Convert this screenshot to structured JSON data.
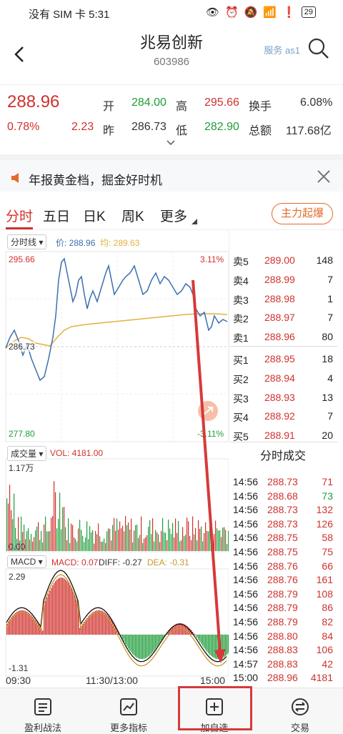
{
  "status": {
    "carrier": "没有 SIM 卡 5:31",
    "battery": "29"
  },
  "nav": {
    "title": "兆易创新",
    "code": "603986",
    "service": "服务 as1"
  },
  "quote": {
    "price": "288.96",
    "pct": "0.78%",
    "change": "2.23",
    "open_label": "开",
    "open": "284.00",
    "high_label": "高",
    "high": "295.66",
    "turnover_label": "换手",
    "turnover": "6.08%",
    "prev_label": "昨",
    "prev": "286.73",
    "low_label": "低",
    "low": "282.90",
    "amount_label": "总额",
    "amount": "117.68亿"
  },
  "banner": {
    "text": "年报黄金档，掘金好时机"
  },
  "tabs": {
    "t1": "分时",
    "t2": "五日",
    "t3": "日K",
    "t4": "周K",
    "t5": "更多",
    "action": "主力起爆"
  },
  "chart": {
    "mode_label": "分时线 ▾",
    "price_legend": "价: 288.96",
    "avg_legend": "均: 289.63",
    "y_top": "295.66",
    "y_mid": "286.73",
    "y_bot": "277.80",
    "pct_top": "3.11%",
    "pct_bot": "-3.11%",
    "vol_label": "成交量 ▾",
    "vol_value": "VOL: 4181.00",
    "vol_max": "1.17万",
    "vol_zero": "0.00",
    "macd_label": "MACD ▾",
    "macd_value": "MACD: 0.07",
    "diff_value": "DIFF: -0.27",
    "dea_value": "DEA: -0.31",
    "macd_top": "2.29",
    "macd_bot": "-1.31",
    "x_start": "09:30",
    "x_mid": "11:30/13:00",
    "x_end": "15:00"
  },
  "orderbook": [
    {
      "label": "卖5",
      "price": "289.00",
      "vol": "148"
    },
    {
      "label": "卖4",
      "price": "288.99",
      "vol": "7"
    },
    {
      "label": "卖3",
      "price": "288.98",
      "vol": "1"
    },
    {
      "label": "卖2",
      "price": "288.97",
      "vol": "7"
    },
    {
      "label": "卖1",
      "price": "288.96",
      "vol": "80"
    },
    {
      "label": "买1",
      "price": "288.95",
      "vol": "18"
    },
    {
      "label": "买2",
      "price": "288.94",
      "vol": "4"
    },
    {
      "label": "买3",
      "price": "288.93",
      "vol": "13"
    },
    {
      "label": "买4",
      "price": "288.92",
      "vol": "7"
    },
    {
      "label": "买5",
      "price": "288.91",
      "vol": "20"
    }
  ],
  "trades_title": "分时成交",
  "trades": [
    {
      "time": "14:56",
      "price": "288.73",
      "vol": "71",
      "dir": "sell"
    },
    {
      "time": "14:56",
      "price": "288.68",
      "vol": "73",
      "dir": "buy"
    },
    {
      "time": "14:56",
      "price": "288.73",
      "vol": "132",
      "dir": "sell"
    },
    {
      "time": "14:56",
      "price": "288.73",
      "vol": "126",
      "dir": "sell"
    },
    {
      "time": "14:56",
      "price": "288.75",
      "vol": "58",
      "dir": "sell"
    },
    {
      "time": "14:56",
      "price": "288.75",
      "vol": "75",
      "dir": "sell"
    },
    {
      "time": "14:56",
      "price": "288.76",
      "vol": "66",
      "dir": "sell"
    },
    {
      "time": "14:56",
      "price": "288.76",
      "vol": "161",
      "dir": "sell"
    },
    {
      "time": "14:56",
      "price": "288.79",
      "vol": "108",
      "dir": "sell"
    },
    {
      "time": "14:56",
      "price": "288.79",
      "vol": "86",
      "dir": "sell"
    },
    {
      "time": "14:56",
      "price": "288.79",
      "vol": "82",
      "dir": "sell"
    },
    {
      "time": "14:56",
      "price": "288.80",
      "vol": "84",
      "dir": "sell"
    },
    {
      "time": "14:56",
      "price": "288.83",
      "vol": "106",
      "dir": "sell"
    },
    {
      "time": "14:57",
      "price": "288.83",
      "vol": "42",
      "dir": "sell"
    },
    {
      "time": "15:00",
      "price": "288.96",
      "vol": "4181",
      "dir": "sell"
    }
  ],
  "bottom": {
    "b1": "盈利战法",
    "b2": "更多指标",
    "b3": "加自选",
    "b4": "交易"
  },
  "colors": {
    "up": "#d0312d",
    "down": "#1f9d3a",
    "price_line": "#3b6fb0",
    "avg_line": "#e3b23c",
    "accent": "#e46a2a"
  }
}
